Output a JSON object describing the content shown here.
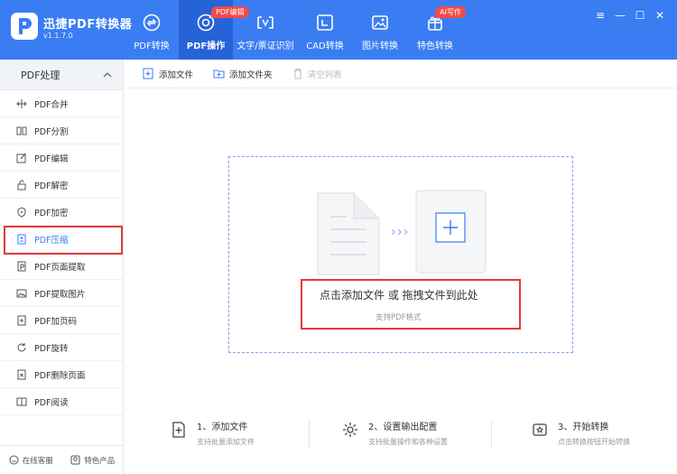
{
  "app": {
    "name": "迅捷PDF转换器",
    "version": "v1.1.7.0"
  },
  "nav": [
    {
      "label": "PDF转换",
      "icon": "pdf-convert-icon",
      "badge": ""
    },
    {
      "label": "PDF操作",
      "icon": "pdf-operate-icon",
      "badge": "PDF编辑",
      "active": true
    },
    {
      "label": "文字/票证识别",
      "icon": "ocr-icon",
      "badge": ""
    },
    {
      "label": "CAD转换",
      "icon": "cad-icon",
      "badge": ""
    },
    {
      "label": "图片转换",
      "icon": "image-icon",
      "badge": ""
    },
    {
      "label": "特色转换",
      "icon": "special-icon",
      "badge": "AI写作"
    }
  ],
  "window": {
    "minimize": "—",
    "restore": "☐",
    "close": "✕"
  },
  "sidebar": {
    "header": "PDF处理",
    "items": [
      {
        "label": "PDF合并"
      },
      {
        "label": "PDF分割"
      },
      {
        "label": "PDF编辑"
      },
      {
        "label": "PDF解密"
      },
      {
        "label": "PDF加密"
      },
      {
        "label": "PDF压缩",
        "active": true
      },
      {
        "label": "PDF页面提取"
      },
      {
        "label": "PDF提取图片"
      },
      {
        "label": "PDF加页码"
      },
      {
        "label": "PDF旋转"
      },
      {
        "label": "PDF删除页面"
      },
      {
        "label": "PDF阅读"
      }
    ],
    "footer": {
      "service": "在线客服",
      "products": "特色产品"
    }
  },
  "toolbar": {
    "add_file": "添加文件",
    "add_folder": "添加文件夹",
    "clear_list": "清空列表"
  },
  "dropzone": {
    "text": "点击添加文件 或 拖拽文件到此处",
    "sub": "支持PDF格式"
  },
  "steps": [
    {
      "title": "1、添加文件",
      "sub": "支持批量添加文件"
    },
    {
      "title": "2、设置输出配置",
      "sub": "支持批量操作和各种设置"
    },
    {
      "title": "3、开始转换",
      "sub": "点击转换按钮开始转换"
    }
  ],
  "colors": {
    "primary": "#3a7df3",
    "active_nav": "#2763d8",
    "badge": "#f24a4a",
    "highlight": "#e33a3a"
  }
}
